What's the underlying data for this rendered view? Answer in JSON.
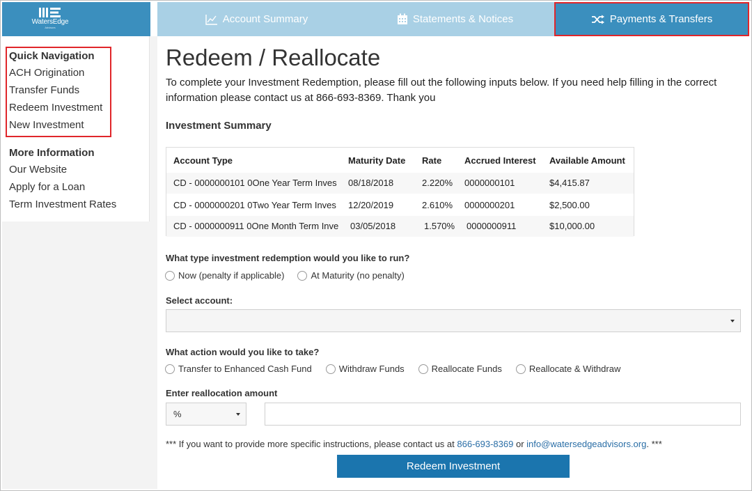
{
  "brand": {
    "logo_text": "WatersEdge",
    "logo_sub": "Advisors"
  },
  "nav": {
    "tabs": [
      {
        "label": "Account Summary",
        "icon": "chart-line-icon"
      },
      {
        "label": "Statements & Notices",
        "icon": "calendar-icon"
      },
      {
        "label": "Payments & Transfers",
        "icon": "shuffle-icon",
        "active": true
      }
    ]
  },
  "sidebar": {
    "quick_nav_heading": "Quick Navigation",
    "quick_nav": [
      "ACH Origination",
      "Transfer Funds",
      "Redeem Investment",
      "New Investment"
    ],
    "more_info_heading": "More Information",
    "more_info": [
      "Our Website",
      "Apply for a Loan",
      "Term Investment Rates"
    ]
  },
  "page": {
    "title": "Redeem / Reallocate",
    "intro": "To complete your Investment Redemption, please fill out the following inputs below. If you need help filling in the correct information please contact us at 866-693-8369. Thank you",
    "summary_heading": "Investment Summary"
  },
  "table": {
    "headers": [
      "Account Type",
      "Maturity Date",
      "Rate",
      "Accrued Interest",
      "Available Amount"
    ],
    "rows": [
      [
        "CD - 0000000101 0One Year Term Inves",
        "08/18/2018",
        "2.220%",
        "0000000101",
        "$4,415.87"
      ],
      [
        "CD - 0000000201 0Two Year Term Inves",
        "12/20/2019",
        "2.610%",
        "0000000201",
        "$2,500.00"
      ],
      [
        "CD - 0000000911 0One Month Term Inve",
        "03/05/2018",
        "1.570%",
        "0000000911",
        "$10,000.00"
      ]
    ]
  },
  "form": {
    "redemption_question": "What type investment redemption would you like to run?",
    "redemption_options": [
      "Now (penalty if applicable)",
      "At Maturity (no penalty)"
    ],
    "select_account_label": "Select account:",
    "select_account_value": "",
    "action_question": "What action would you like to take?",
    "action_options": [
      "Transfer to Enhanced Cash Fund",
      "Withdraw Funds",
      "Reallocate Funds",
      "Reallocate & Withdraw"
    ],
    "amount_label": "Enter reallocation amount",
    "amount_unit": "%",
    "amount_value": "",
    "note_prefix": "*** If you want to provide more specific instructions, please contact us at",
    "note_phone": "866-693-8369",
    "note_or": "or",
    "note_email": "info@watersedgeadvisors.org",
    "note_suffix": ". ***",
    "submit_label": "Redeem Investment"
  },
  "colors": {
    "brand": "#3b8fbe",
    "nav_bg": "#a9d0e5",
    "button": "#1b75ae",
    "highlight": "#e0262a",
    "link": "#2a6ea6"
  }
}
